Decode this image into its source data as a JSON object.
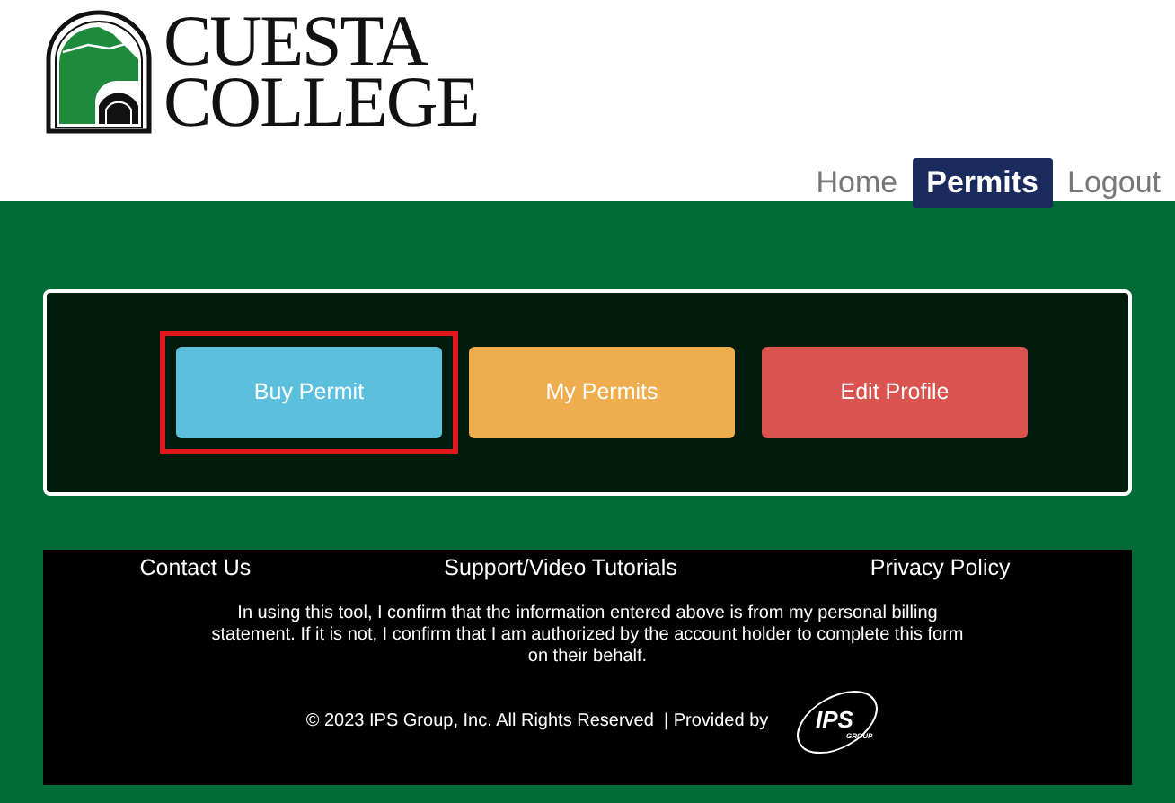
{
  "logo": {
    "lines": [
      "CUESTA",
      "COLLEGE"
    ]
  },
  "nav": [
    {
      "label": "Home",
      "selected": false
    },
    {
      "label": "Permits",
      "selected": true
    },
    {
      "label": "Logout",
      "selected": false
    }
  ],
  "actions": [
    {
      "label": "Buy Permit",
      "color": "#5bc0de",
      "highlighted": true
    },
    {
      "label": "My Permits",
      "color": "#f0ad4e",
      "highlighted": false
    },
    {
      "label": "Edit Profile",
      "color": "#d9534f",
      "highlighted": false
    }
  ],
  "footer": {
    "links": [
      "Contact Us",
      "Support/Video Tutorials",
      "Privacy Policy"
    ],
    "disclaimer": "In using this tool, I confirm that the information entered above is from my personal billing statement. If it is not, I confirm that I am authorized by the account holder to complete this form on their behalf.",
    "copyright": "© 2023 IPS Group, Inc. All Rights Reserved  | Provided by",
    "provider_logo": {
      "name": "IPS",
      "sub": "GROUP"
    }
  }
}
